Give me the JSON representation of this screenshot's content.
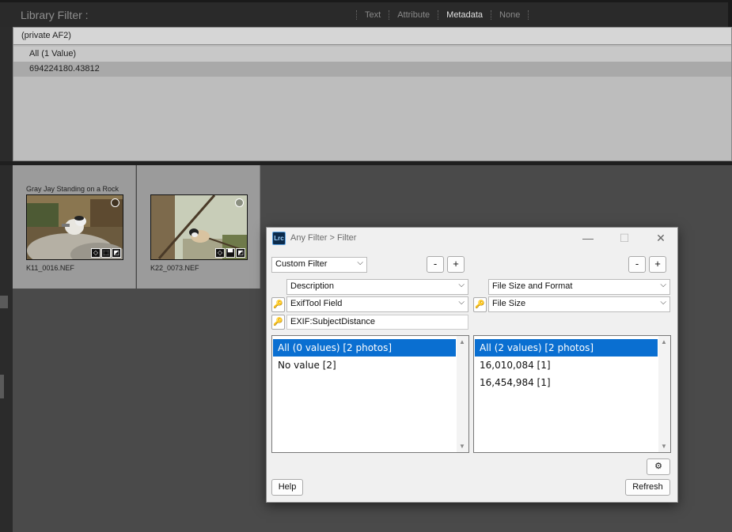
{
  "library_filter": {
    "title": "Library Filter :",
    "tabs": [
      {
        "label": "Text",
        "active": false
      },
      {
        "label": "Attribute",
        "active": false
      },
      {
        "label": "Metadata",
        "active": true
      },
      {
        "label": "None",
        "active": false
      }
    ]
  },
  "metadata_column": {
    "header": "(private AF2)",
    "rows": [
      {
        "label": "All (1 Value)",
        "selected": false
      },
      {
        "label": "694224180.43812",
        "selected": true
      }
    ]
  },
  "grid": {
    "cells": [
      {
        "title": "Gray Jay Standing on a Rock",
        "filename": "K11_0016.NEF"
      },
      {
        "title": "",
        "filename": "K22_0073.NEF"
      }
    ]
  },
  "dialog": {
    "logo": "Lrc",
    "title": "Any Filter > Filter",
    "window_buttons": {
      "minimize": "—",
      "maximize": "☐",
      "close": "✕"
    },
    "preset": "Custom Filter",
    "minus": "-",
    "plus": "+",
    "left_column": {
      "criteria": "Description",
      "field": "ExifTool Field",
      "tag": "EXIF:SubjectDistance",
      "values": [
        {
          "label": "All (0 values) [2 photos]",
          "selected": true
        },
        {
          "label": "No value [2]",
          "selected": false
        }
      ]
    },
    "right_column": {
      "criteria": "File Size and Format",
      "field": "File Size",
      "values": [
        {
          "label": "All (2 values) [2 photos]",
          "selected": true
        },
        {
          "label": "16,010,084 [1]",
          "selected": false
        },
        {
          "label": "16,454,984 [1]",
          "selected": false
        }
      ]
    },
    "settings_icon": "gear-icon",
    "help_label": "Help",
    "refresh_label": "Refresh"
  }
}
